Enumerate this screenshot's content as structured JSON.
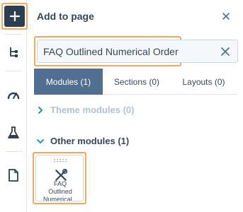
{
  "panel": {
    "title": "Add to page"
  },
  "search": {
    "value": "FAQ Outlined Numerical Order"
  },
  "tabs": [
    {
      "label": "Modules (1)",
      "active": true
    },
    {
      "label": "Sections (0)",
      "active": false
    },
    {
      "label": "Layouts (0)",
      "active": false
    }
  ],
  "sections": {
    "theme": {
      "label": "Theme modules (0)",
      "expanded": false
    },
    "other": {
      "label": "Other modules (1)",
      "expanded": true
    }
  },
  "modules": [
    {
      "name_line1": "FAQ",
      "name_line2": "Outlined",
      "name_line3": "Numerical...",
      "icon": "tools-icon"
    }
  ],
  "rail": {
    "items": [
      "plus-icon",
      "structure-tree-icon",
      "gauge-icon",
      "flask-icon",
      "page-icon"
    ]
  },
  "colors": {
    "highlight": "#f5a85a",
    "rail_active_bg": "#2d3e50",
    "tab_active_bg": "#516f90",
    "teal": "#0091ae",
    "disabled_text": "#b0c1d4",
    "text": "#33475b"
  }
}
